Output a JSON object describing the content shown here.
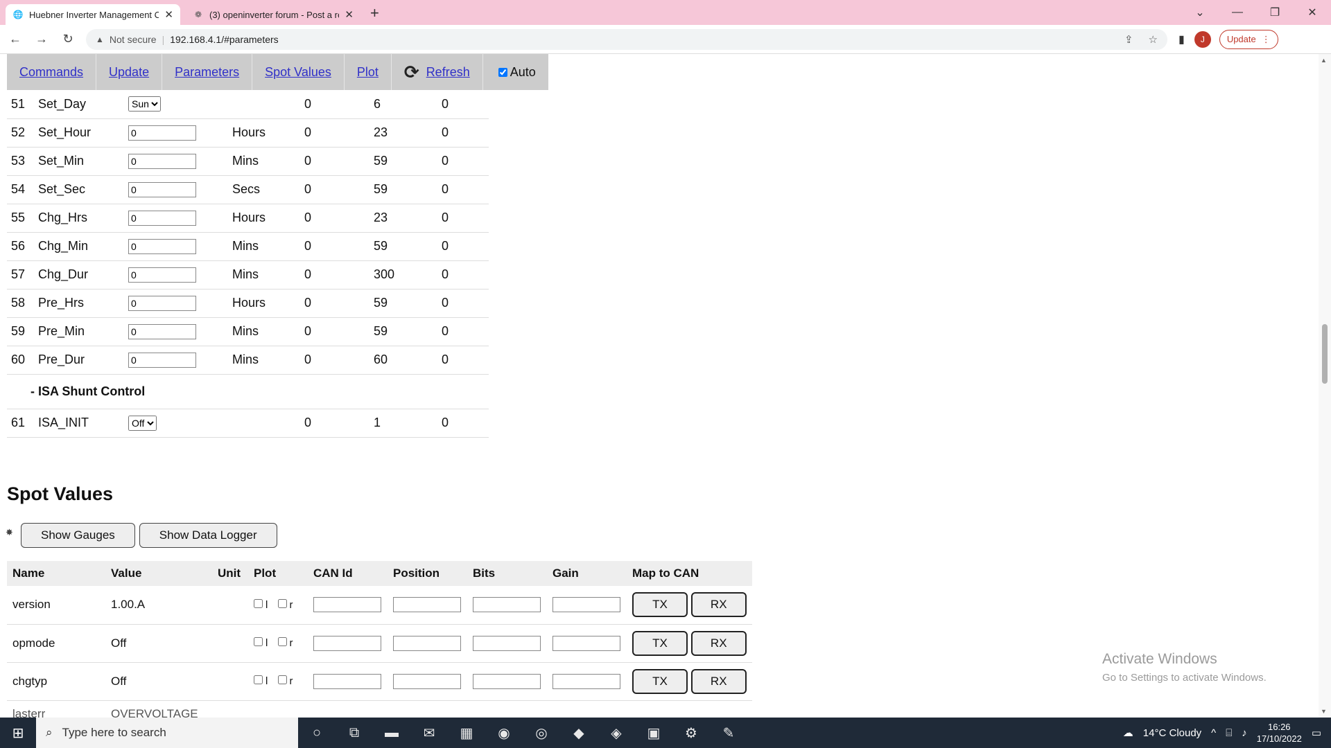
{
  "browser": {
    "tabs": [
      {
        "title": "Huebner Inverter Management C",
        "icon": "globe-icon",
        "active": true
      },
      {
        "title": "(3) openinverter forum - Post a re",
        "icon": "forum-icon",
        "active": false
      }
    ],
    "new_tab": "+",
    "url_warning": "Not secure",
    "url": "192.168.4.1/#parameters",
    "profile_initial": "J",
    "update_label": "Update"
  },
  "nav": {
    "items": [
      "Commands",
      "Update",
      "Parameters",
      "Spot Values",
      "Plot"
    ],
    "refresh_label": "Refresh",
    "auto_label": "Auto",
    "auto_checked": true
  },
  "parameters": [
    {
      "num": "51",
      "name": "Set_Day",
      "type": "select",
      "value": "Sun",
      "unit": "",
      "min": "0",
      "max": "6",
      "def": "0"
    },
    {
      "num": "52",
      "name": "Set_Hour",
      "type": "input",
      "value": "0",
      "unit": "Hours",
      "min": "0",
      "max": "23",
      "def": "0"
    },
    {
      "num": "53",
      "name": "Set_Min",
      "type": "input",
      "value": "0",
      "unit": "Mins",
      "min": "0",
      "max": "59",
      "def": "0"
    },
    {
      "num": "54",
      "name": "Set_Sec",
      "type": "input",
      "value": "0",
      "unit": "Secs",
      "min": "0",
      "max": "59",
      "def": "0"
    },
    {
      "num": "55",
      "name": "Chg_Hrs",
      "type": "input",
      "value": "0",
      "unit": "Hours",
      "min": "0",
      "max": "23",
      "def": "0"
    },
    {
      "num": "56",
      "name": "Chg_Min",
      "type": "input",
      "value": "0",
      "unit": "Mins",
      "min": "0",
      "max": "59",
      "def": "0"
    },
    {
      "num": "57",
      "name": "Chg_Dur",
      "type": "input",
      "value": "0",
      "unit": "Mins",
      "min": "0",
      "max": "300",
      "def": "0"
    },
    {
      "num": "58",
      "name": "Pre_Hrs",
      "type": "input",
      "value": "0",
      "unit": "Hours",
      "min": "0",
      "max": "59",
      "def": "0"
    },
    {
      "num": "59",
      "name": "Pre_Min",
      "type": "input",
      "value": "0",
      "unit": "Mins",
      "min": "0",
      "max": "59",
      "def": "0"
    },
    {
      "num": "60",
      "name": "Pre_Dur",
      "type": "input",
      "value": "0",
      "unit": "Mins",
      "min": "0",
      "max": "60",
      "def": "0"
    }
  ],
  "section_isa": "- ISA Shunt Control",
  "isa_param": {
    "num": "61",
    "name": "ISA_INIT",
    "type": "select",
    "value": "Off",
    "unit": "",
    "min": "0",
    "max": "1",
    "def": "0"
  },
  "spot": {
    "title": "Spot Values",
    "show_gauges": "Show Gauges",
    "show_logger": "Show Data Logger",
    "headers": [
      "Name",
      "Value",
      "Unit",
      "Plot",
      "CAN Id",
      "Position",
      "Bits",
      "Gain",
      "Map to CAN"
    ],
    "plot_l": "l",
    "plot_r": "r",
    "tx_label": "TX",
    "rx_label": "RX",
    "rows": [
      {
        "name": "version",
        "value": "1.00.A",
        "unit": ""
      },
      {
        "name": "opmode",
        "value": "Off",
        "unit": ""
      },
      {
        "name": "chgtyp",
        "value": "Off",
        "unit": ""
      }
    ],
    "partial_row": {
      "name": "lasterr",
      "value": "OVERVOLTAGE"
    }
  },
  "activate": {
    "line1": "Activate Windows",
    "line2": "Go to Settings to activate Windows."
  },
  "taskbar": {
    "search_placeholder": "Type here to search",
    "weather": "14°C  Cloudy",
    "time": "16:26",
    "date": "17/10/2022"
  }
}
